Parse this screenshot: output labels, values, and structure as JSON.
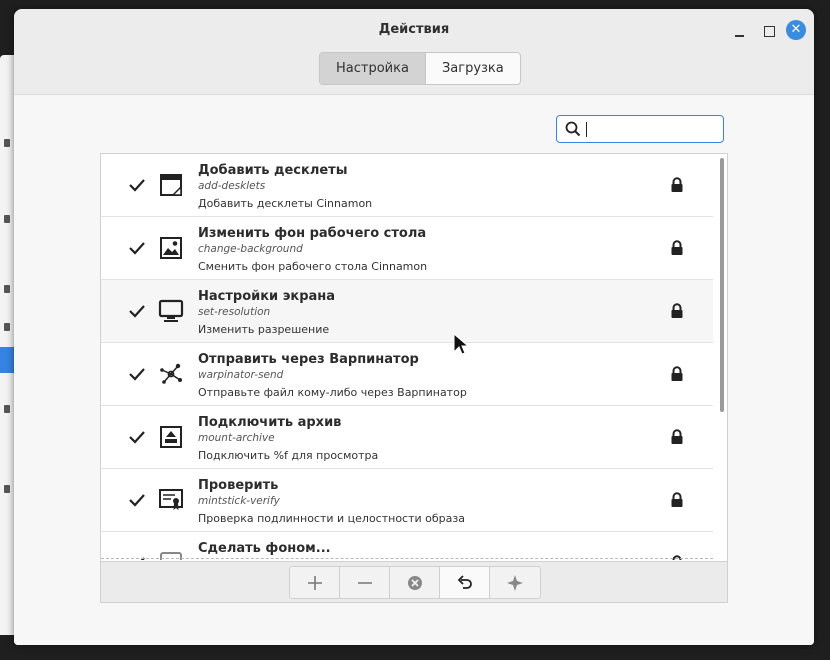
{
  "window": {
    "title": "Действия"
  },
  "tabs": [
    {
      "label": "Настройка",
      "active": true
    },
    {
      "label": "Загрузка",
      "active": false
    }
  ],
  "search": {
    "value": "",
    "placeholder": ""
  },
  "actions": [
    {
      "name": "Добавить десклеты",
      "uuid": "add-desklets",
      "description": "Добавить десклеты Cinnamon",
      "enabled": true,
      "icon": "desklet-icon"
    },
    {
      "name": "Изменить фон рабочего стола",
      "uuid": "change-background",
      "description": "Сменить фон рабочего стола Cinnamon",
      "enabled": true,
      "icon": "image-icon"
    },
    {
      "name": "Настройки экрана",
      "uuid": "set-resolution",
      "description": "Изменить разрешение",
      "enabled": true,
      "icon": "monitor-icon"
    },
    {
      "name": "Отправить через Варпинатор",
      "uuid": "warpinator-send",
      "description": "Отправьте файл кому-либо через Варпинатор",
      "enabled": true,
      "icon": "network-share-icon"
    },
    {
      "name": "Подключить архив",
      "uuid": "mount-archive",
      "description": "Подключить %f для просмотра",
      "enabled": true,
      "icon": "archive-mount-icon"
    },
    {
      "name": "Проверить",
      "uuid": "mintstick-verify",
      "description": "Проверка подлинности и целостности образа",
      "enabled": true,
      "icon": "certificate-icon"
    },
    {
      "name": "Сделать фоном...",
      "uuid": "",
      "description": "",
      "enabled": true,
      "icon": "wallpaper-icon"
    }
  ],
  "toolbar": {
    "buttons": [
      "add-icon",
      "remove-icon",
      "clear-icon",
      "undo-icon",
      "sparkle-icon"
    ]
  },
  "colors": {
    "accent": "#3584e4",
    "close_button": "#3a8cde"
  }
}
